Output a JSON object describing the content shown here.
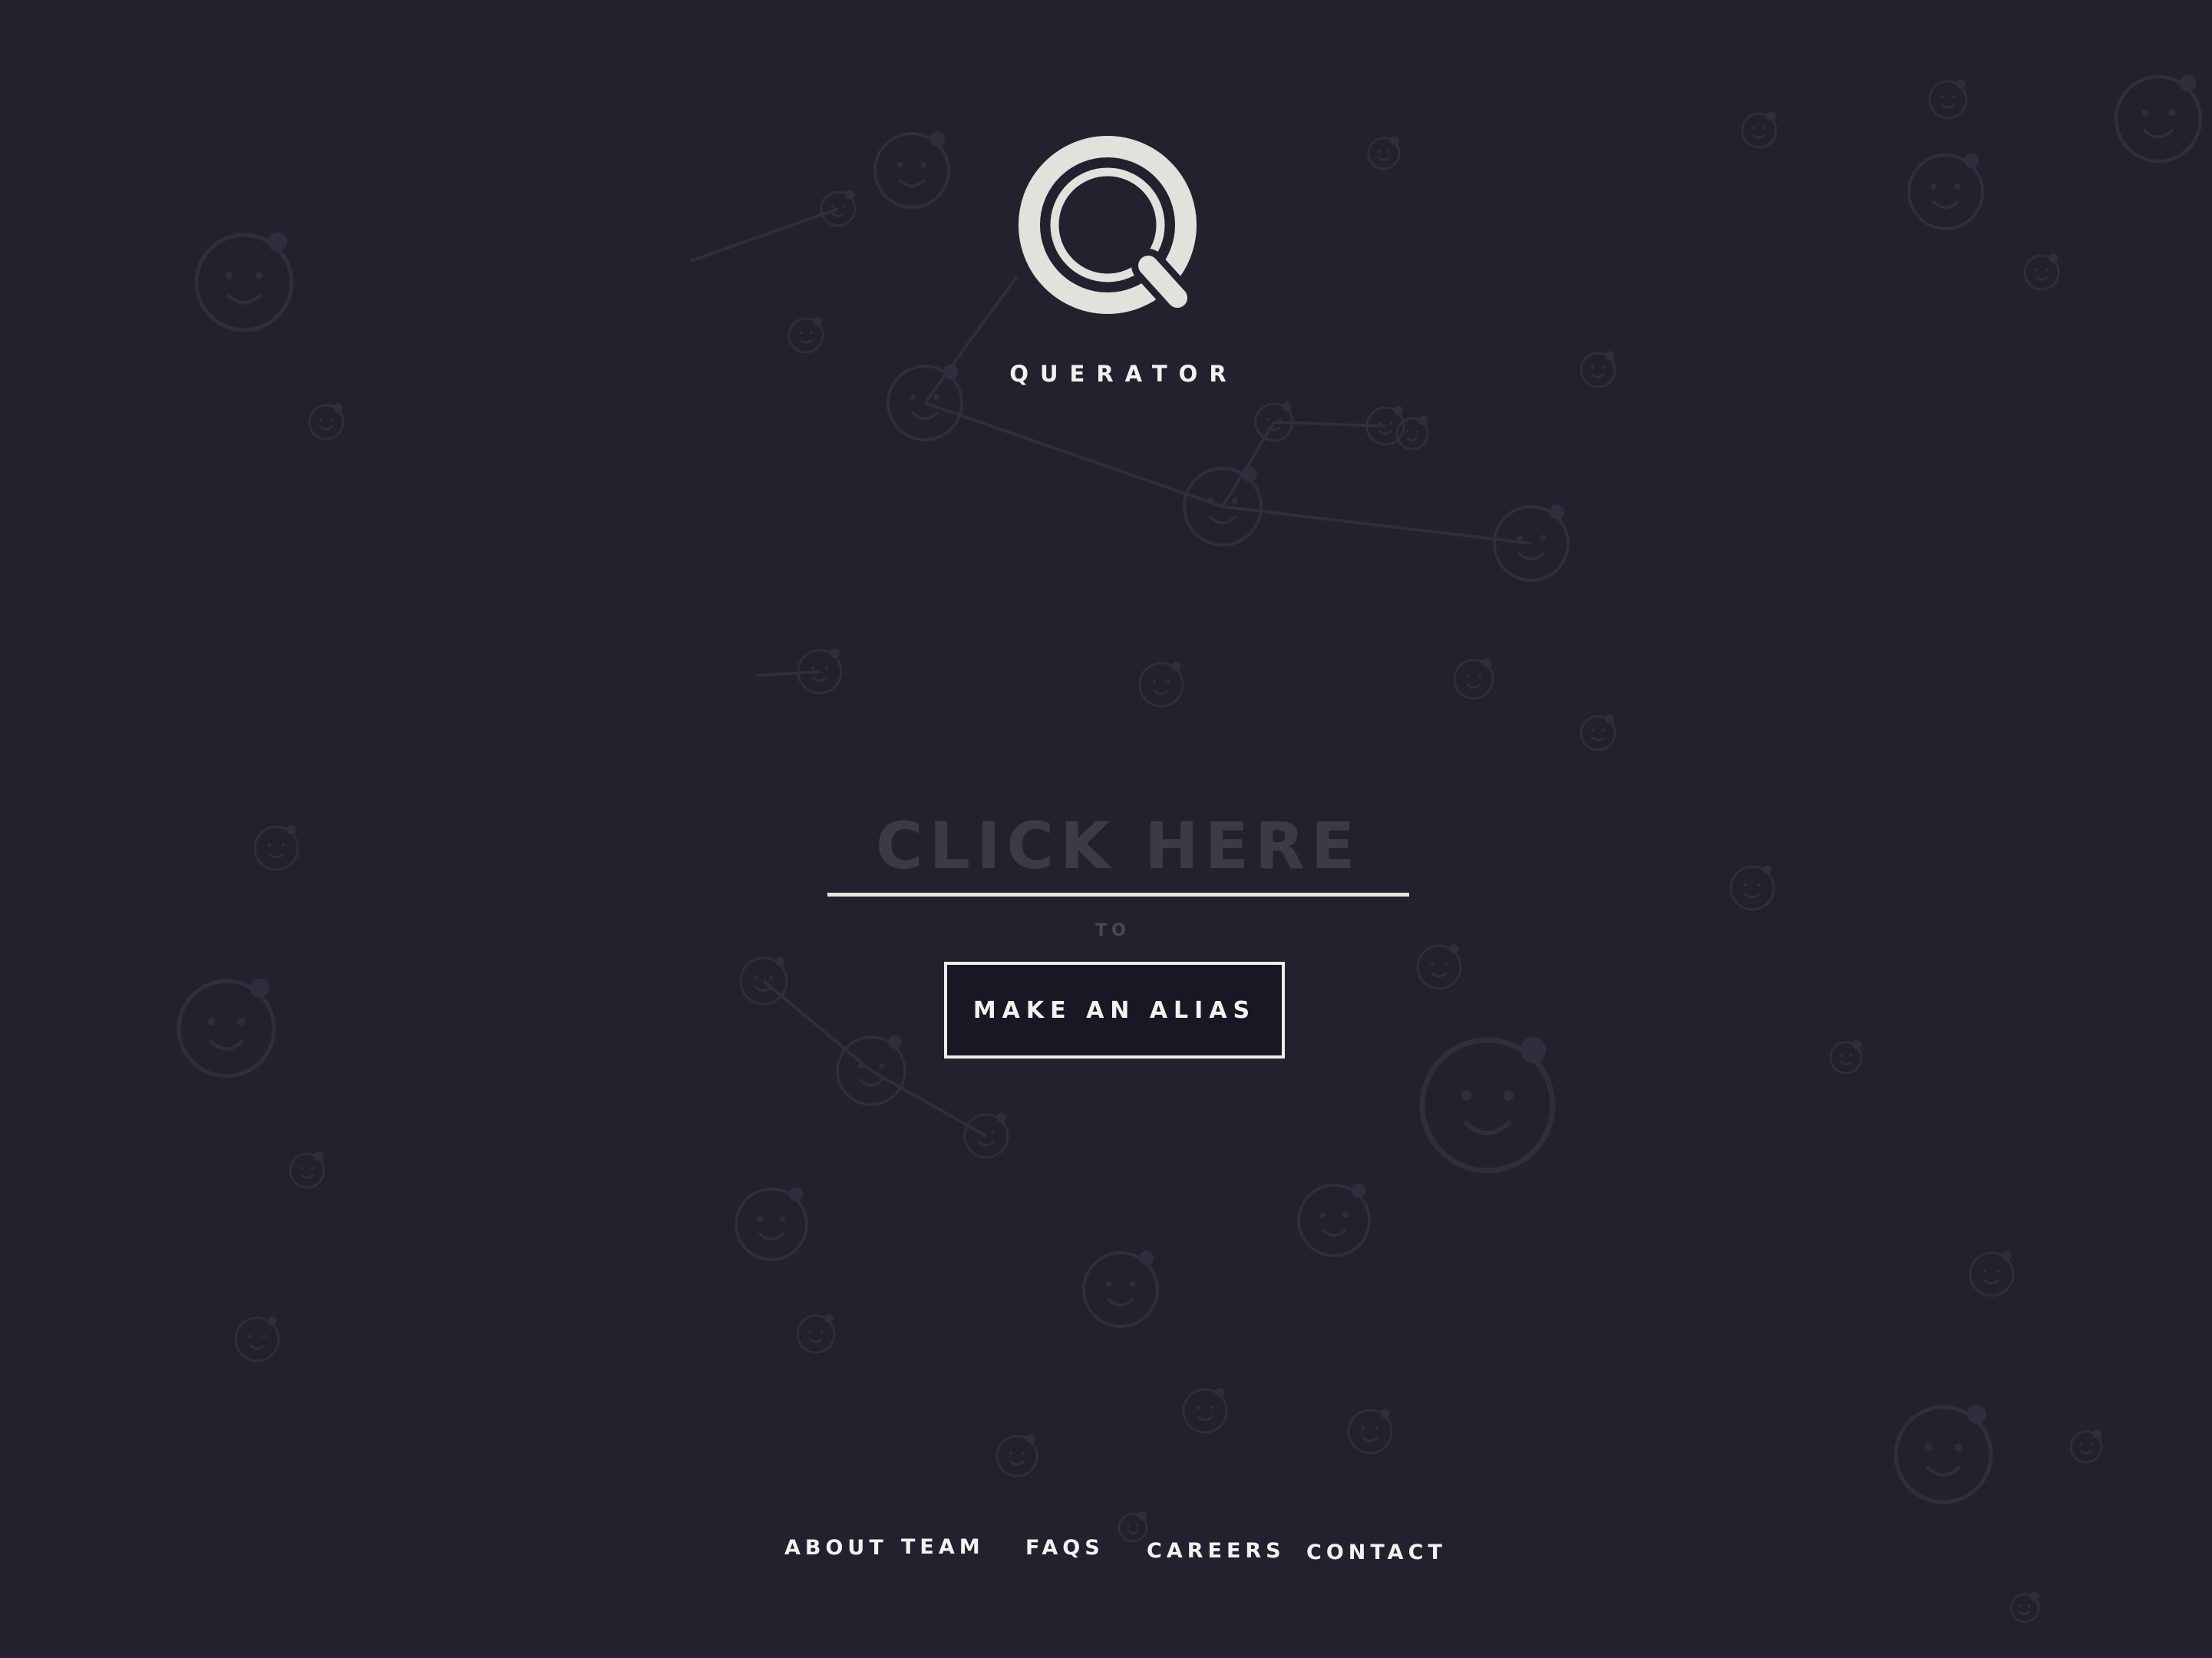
{
  "brand": {
    "name": "QUERATOR",
    "logo_icon": "magnifier-q-icon"
  },
  "alias_form": {
    "input_placeholder": "CLICK HERE",
    "input_value": "",
    "connector_text": "TO",
    "submit_label": "MAKE AN ALIAS"
  },
  "footer": {
    "links": [
      {
        "label": "ABOUT"
      },
      {
        "label": "TEAM"
      },
      {
        "label": "FAQS"
      },
      {
        "label": "CAREERS"
      },
      {
        "label": "CONTACT"
      }
    ]
  },
  "background": {
    "decoration": "doodle-faces-network-illustration"
  },
  "colors": {
    "background": "#23212e",
    "foreground": "#f4f2ee",
    "placeholder": "#3c3a47",
    "doodle_stroke": "#302e3c",
    "button_fill": "#191724"
  }
}
